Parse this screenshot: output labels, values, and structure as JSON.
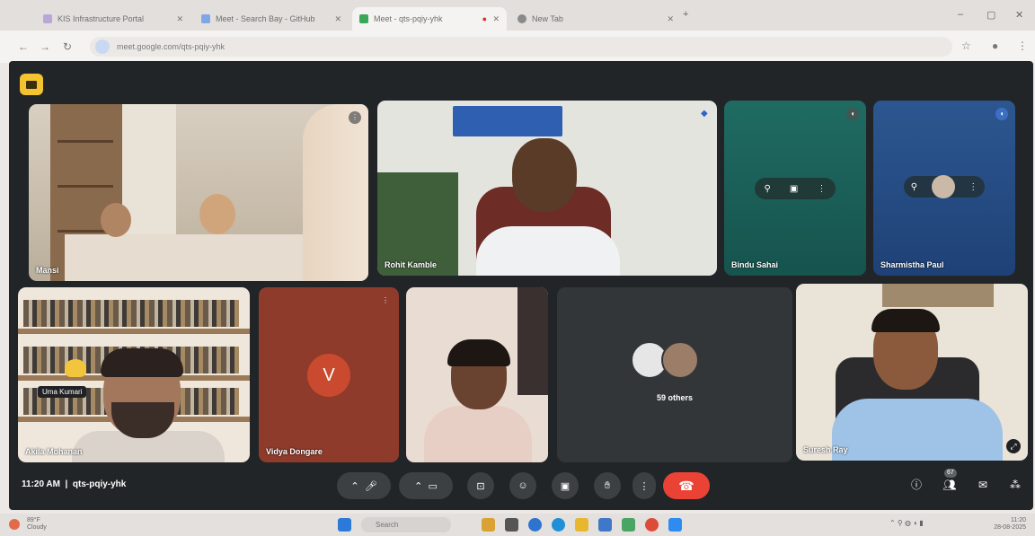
{
  "browser": {
    "tabs": [
      {
        "label": "KIS Infrastructure Portal",
        "active": false
      },
      {
        "label": "Meet - Search Bay - GitHub",
        "active": false
      },
      {
        "label": "Meet - qts-pqiy-yhk",
        "active": true
      },
      {
        "label": "New Tab",
        "active": false
      }
    ],
    "url": "meet.google.com/qts-pqiy-yhk"
  },
  "meeting": {
    "tiles": [
      {
        "name": "Mansi"
      },
      {
        "name": "Rohit Kamble"
      },
      {
        "name": "Bindu Sahai"
      },
      {
        "name": "Sharmistha Paul"
      },
      {
        "name": "Akila Mohanan",
        "tag": "Uma Kumari"
      },
      {
        "name": "Vidya Dongare",
        "initial": "V"
      },
      {
        "name": ""
      },
      {
        "name": "",
        "others": "59 others"
      },
      {
        "name": "Suresh Ray"
      }
    ],
    "time": "11:20 AM",
    "code": "qts-pqiy-yhk",
    "participants_count": "67"
  },
  "taskbar": {
    "weather": "89°F",
    "weather_sub": "Cloudy",
    "search": "Search",
    "time": "11:20",
    "date": "28-08-2025"
  },
  "colors": {
    "end_call": "#ea4335",
    "meet_bg": "#222527",
    "logo": "#f4c430"
  }
}
